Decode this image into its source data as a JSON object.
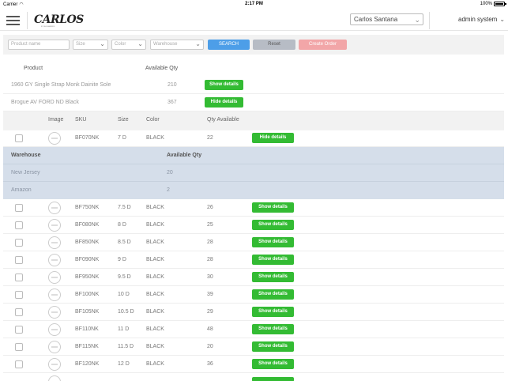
{
  "status_bar": {
    "carrier": "Carrier",
    "time": "2:17 PM",
    "battery": "100%"
  },
  "nav": {
    "logo": "CARLOS",
    "logo_sub": "BY SHOEMAKERS",
    "user_select": "Carlos Santana",
    "admin_label": "admin system"
  },
  "filters": {
    "product_name_placeholder": "Product name",
    "size_placeholder": "Size",
    "color_placeholder": "Color",
    "warehouse_placeholder": "Warehouse",
    "search_label": "SEARCH",
    "reset_label": "Reset",
    "create_order_label": "Create Order"
  },
  "products_header": {
    "product": "Product",
    "available_qty": "Available Qty"
  },
  "products": [
    {
      "name": "1960 GY Single Strap Monk Dainite Sole",
      "qty": "210",
      "button": "Show details"
    },
    {
      "name": "Brogue AV FORD ND Black",
      "qty": "367",
      "button": "Hide details"
    }
  ],
  "sku_header": {
    "image": "Image",
    "sku": "SKU",
    "size": "Size",
    "color": "Color",
    "qty": "Qty Available"
  },
  "expanded_sku": {
    "sku": "BF070NK",
    "size": "7 D",
    "color": "BLACK",
    "qty": "22",
    "button": "Hide details"
  },
  "warehouse": {
    "header_label": "Warehouse",
    "header_qty": "Available Qty",
    "rows": [
      {
        "name": "New Jersey",
        "qty": "20"
      },
      {
        "name": "Amazon",
        "qty": "2"
      }
    ]
  },
  "skus": [
    {
      "sku": "BF750NK",
      "size": "7.5 D",
      "color": "BLACK",
      "qty": "26",
      "button": "Show details"
    },
    {
      "sku": "BF080NK",
      "size": "8 D",
      "color": "BLACK",
      "qty": "25",
      "button": "Show details"
    },
    {
      "sku": "BF850NK",
      "size": "8.5 D",
      "color": "BLACK",
      "qty": "28",
      "button": "Show details"
    },
    {
      "sku": "BF090NK",
      "size": "9 D",
      "color": "BLACK",
      "qty": "28",
      "button": "Show details"
    },
    {
      "sku": "BF950NK",
      "size": "9.5 D",
      "color": "BLACK",
      "qty": "30",
      "button": "Show details"
    },
    {
      "sku": "BF100NK",
      "size": "10 D",
      "color": "BLACK",
      "qty": "39",
      "button": "Show details"
    },
    {
      "sku": "BF105NK",
      "size": "10.5 D",
      "color": "BLACK",
      "qty": "29",
      "button": "Show details"
    },
    {
      "sku": "BF110NK",
      "size": "11 D",
      "color": "BLACK",
      "qty": "48",
      "button": "Show details"
    },
    {
      "sku": "BF115NK",
      "size": "11.5 D",
      "color": "BLACK",
      "qty": "20",
      "button": "Show details"
    },
    {
      "sku": "BF120NK",
      "size": "12 D",
      "color": "BLACK",
      "qty": "36",
      "button": "Show details"
    }
  ],
  "colors": {
    "green": "#33bb33",
    "search_blue": "#4d9ee8",
    "create_pink": "#f2a6a8",
    "warehouse_bg": "#d5deea"
  }
}
